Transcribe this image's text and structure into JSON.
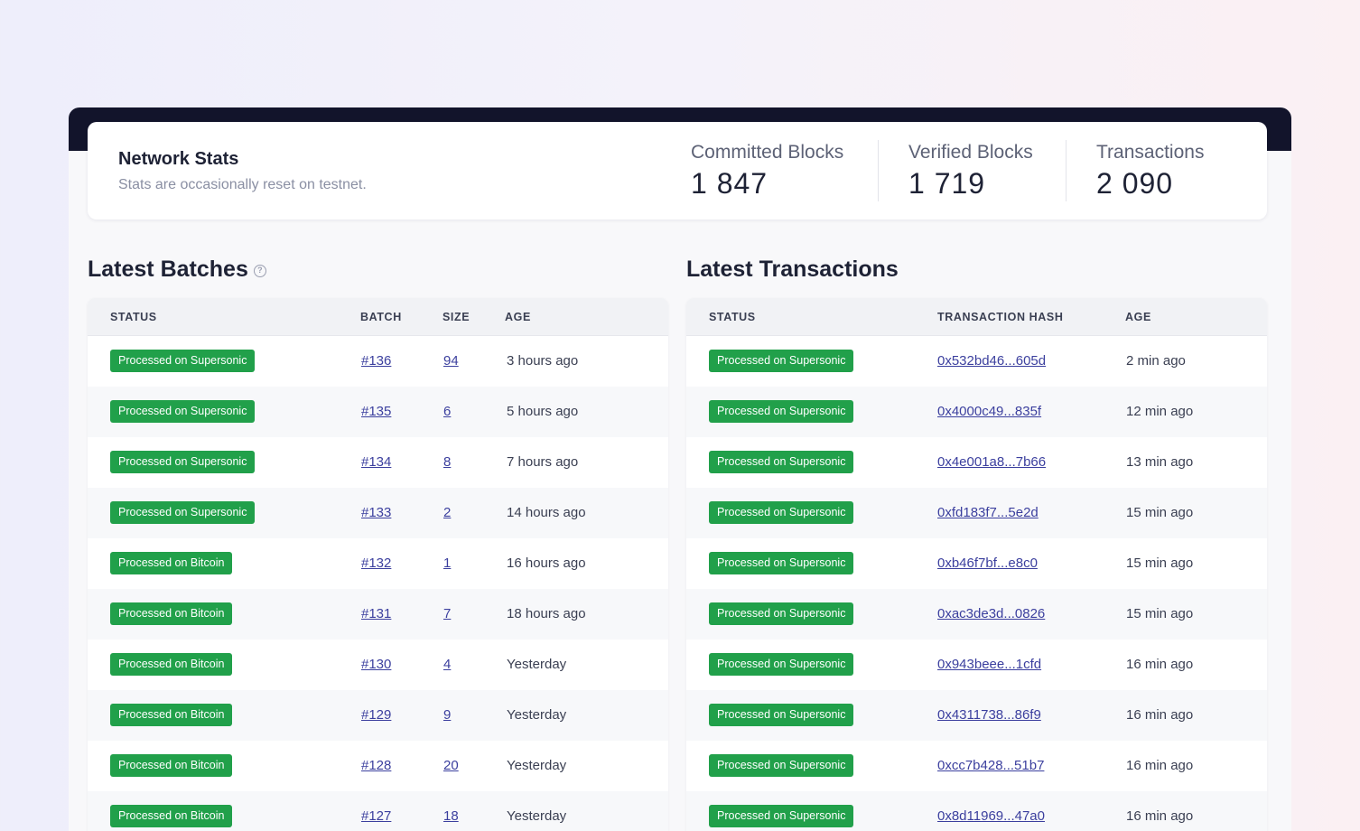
{
  "stats": {
    "title": "Network Stats",
    "subtitle": "Stats are occasionally reset on testnet.",
    "items": [
      {
        "label": "Committed Blocks",
        "value": "1 847"
      },
      {
        "label": "Verified Blocks",
        "value": "1 719"
      },
      {
        "label": "Transactions",
        "value": "2 090"
      }
    ]
  },
  "batches": {
    "title": "Latest Batches",
    "help_icon": "question-circle-icon",
    "columns": [
      "STATUS",
      "BATCH",
      "SIZE",
      "AGE"
    ],
    "rows": [
      {
        "status": "Processed on Supersonic",
        "batch": "#136",
        "size": "94",
        "age": "3 hours ago"
      },
      {
        "status": "Processed on Supersonic",
        "batch": "#135",
        "size": "6",
        "age": "5 hours ago"
      },
      {
        "status": "Processed on Supersonic",
        "batch": "#134",
        "size": "8",
        "age": "7 hours ago"
      },
      {
        "status": "Processed on Supersonic",
        "batch": "#133",
        "size": "2",
        "age": "14 hours ago"
      },
      {
        "status": "Processed on Bitcoin",
        "batch": "#132",
        "size": "1",
        "age": "16 hours ago"
      },
      {
        "status": "Processed on Bitcoin",
        "batch": "#131",
        "size": "7",
        "age": "18 hours ago"
      },
      {
        "status": "Processed on Bitcoin",
        "batch": "#130",
        "size": "4",
        "age": "Yesterday"
      },
      {
        "status": "Processed on Bitcoin",
        "batch": "#129",
        "size": "9",
        "age": "Yesterday"
      },
      {
        "status": "Processed on Bitcoin",
        "batch": "#128",
        "size": "20",
        "age": "Yesterday"
      },
      {
        "status": "Processed on Bitcoin",
        "batch": "#127",
        "size": "18",
        "age": "Yesterday"
      }
    ]
  },
  "transactions": {
    "title": "Latest Transactions",
    "columns": [
      "STATUS",
      "TRANSACTION HASH",
      "AGE"
    ],
    "rows": [
      {
        "status": "Processed on Supersonic",
        "hash": "0x532bd46...605d",
        "age": "2 min ago"
      },
      {
        "status": "Processed on Supersonic",
        "hash": "0x4000c49...835f",
        "age": "12 min ago"
      },
      {
        "status": "Processed on Supersonic",
        "hash": "0x4e001a8...7b66",
        "age": "13 min ago"
      },
      {
        "status": "Processed on Supersonic",
        "hash": "0xfd183f7...5e2d",
        "age": "15 min ago"
      },
      {
        "status": "Processed on Supersonic",
        "hash": "0xb46f7bf...e8c0",
        "age": "15 min ago"
      },
      {
        "status": "Processed on Supersonic",
        "hash": "0xac3de3d...0826",
        "age": "15 min ago"
      },
      {
        "status": "Processed on Supersonic",
        "hash": "0x943beee...1cfd",
        "age": "16 min ago"
      },
      {
        "status": "Processed on Supersonic",
        "hash": "0x4311738...86f9",
        "age": "16 min ago"
      },
      {
        "status": "Processed on Supersonic",
        "hash": "0xcc7b428...51b7",
        "age": "16 min ago"
      },
      {
        "status": "Processed on Supersonic",
        "hash": "0x8d11969...47a0",
        "age": "16 min ago"
      }
    ]
  },
  "colors": {
    "badge_green": "#21a04a",
    "link": "#3b3f9e",
    "topbar": "#12142b"
  }
}
